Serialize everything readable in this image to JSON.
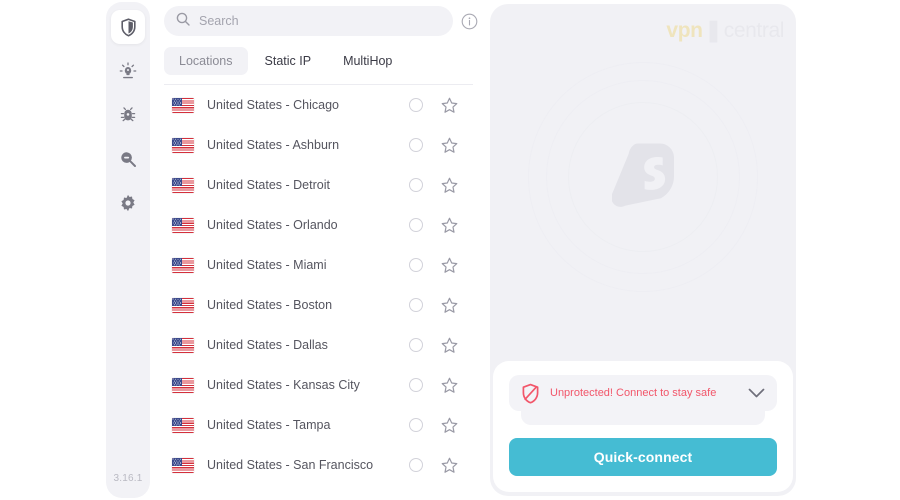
{
  "sidebar": {
    "items": [
      {
        "name": "vpn",
        "icon": "shield-icon",
        "active": true
      },
      {
        "name": "alert",
        "icon": "alert-bulb-icon",
        "active": false
      },
      {
        "name": "antivirus",
        "icon": "bug-icon",
        "active": false
      },
      {
        "name": "search",
        "icon": "search-minus-icon",
        "active": false
      },
      {
        "name": "settings",
        "icon": "gear-icon",
        "active": false
      }
    ],
    "version": "3.16.1"
  },
  "search": {
    "placeholder": "Search",
    "value": "",
    "icon": "search-icon",
    "info_icon": "info-circle-icon"
  },
  "tabs": [
    {
      "label": "Locations",
      "active": true
    },
    {
      "label": "Static IP",
      "active": false
    },
    {
      "label": "MultiHop",
      "active": false
    }
  ],
  "locations": [
    {
      "label": "United States - Chicago",
      "flag": "us-flag-icon",
      "selected": false,
      "favorite": false
    },
    {
      "label": "United States - Ashburn",
      "flag": "us-flag-icon",
      "selected": false,
      "favorite": false
    },
    {
      "label": "United States - Detroit",
      "flag": "us-flag-icon",
      "selected": false,
      "favorite": false
    },
    {
      "label": "United States - Orlando",
      "flag": "us-flag-icon",
      "selected": false,
      "favorite": false
    },
    {
      "label": "United States - Miami",
      "flag": "us-flag-icon",
      "selected": false,
      "favorite": false
    },
    {
      "label": "United States - Boston",
      "flag": "us-flag-icon",
      "selected": false,
      "favorite": false
    },
    {
      "label": "United States - Dallas",
      "flag": "us-flag-icon",
      "selected": false,
      "favorite": false
    },
    {
      "label": "United States - Kansas City",
      "flag": "us-flag-icon",
      "selected": false,
      "favorite": false
    },
    {
      "label": "United States - Tampa",
      "flag": "us-flag-icon",
      "selected": false,
      "favorite": false
    },
    {
      "label": "United States - San Francisco",
      "flag": "us-flag-icon",
      "selected": false,
      "favorite": false
    }
  ],
  "panel": {
    "watermark": {
      "brand": "vpn",
      "separator": "❚",
      "suffix": "central"
    },
    "logo_icon": "surfshark-logo-icon",
    "status": {
      "icon": "shield-off-icon",
      "text": "Unprotected! Connect to stay safe",
      "chevron": "chevron-down-icon"
    },
    "quick_connect_label": "Quick-connect"
  },
  "colors": {
    "accent": "#45bcd3",
    "danger": "#f2566a",
    "panel_bg": "#f1f1f5",
    "brand_yellow": "#efe2b4"
  }
}
